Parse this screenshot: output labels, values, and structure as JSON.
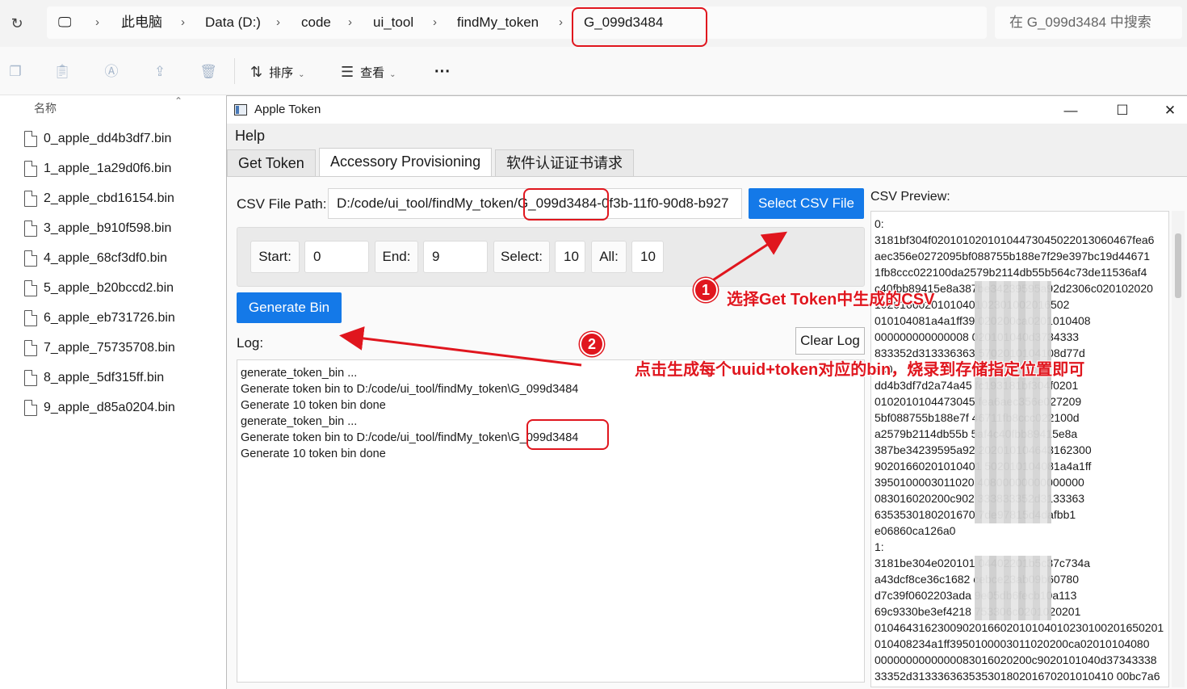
{
  "explorer": {
    "breadcrumb": [
      "此电脑",
      "Data (D:)",
      "code",
      "ui_tool",
      "findMy_token",
      "G_099d3484"
    ],
    "search_placeholder": "在 G_099d3484 中搜索",
    "toolbar": {
      "sort_label": "排序",
      "view_label": "查看",
      "more_label": "···"
    },
    "column_name": "名称",
    "files": [
      "0_apple_dd4b3df7.bin",
      "1_apple_1a29d0f6.bin",
      "2_apple_cbd16154.bin",
      "3_apple_b910f598.bin",
      "4_apple_68cf3df0.bin",
      "5_apple_b20bccd2.bin",
      "6_apple_eb731726.bin",
      "7_apple_75735708.bin",
      "8_apple_5df315ff.bin",
      "9_apple_d85a0204.bin"
    ]
  },
  "app": {
    "title": "Apple Token",
    "menu_help": "Help",
    "tabs": [
      "Get Token",
      "Accessory Provisioning",
      "软件认证证书请求"
    ],
    "active_tab": 1,
    "csv_label": "CSV File Path:",
    "csv_path": "D:/code/ui_tool/findMy_token/G_099d3484-0f3b-11f0-90d8-b927",
    "select_csv_button": "Select CSV File",
    "range": {
      "start_label": "Start:",
      "start_value": "0",
      "end_label": "End:",
      "end_value": "9",
      "select_label": "Select:",
      "select_value": "10",
      "all_label": "All:",
      "all_value": "10"
    },
    "generate_bin_button": "Generate Bin",
    "log_label": "Log:",
    "clear_log_button": "Clear Log",
    "log_lines": [
      "generate_token_bin ...",
      "Generate token bin to D:/code/ui_tool/findMy_token\\G_099d3484",
      "Generate 10 token bin done",
      "generate_token_bin ...",
      "Generate token bin to D:/code/ui_tool/findMy_token\\G_099d3484",
      "Generate 10 token bin done"
    ],
    "preview_label": "CSV Preview:",
    "preview_lines": [
      "0:",
      "3181bf304f02010102010104473045022013060467fea6",
      "aec356e0272095bf088755b188e7f29e397bc19d44671",
      "1fb8ccc022100da2579b2114db55b564c73de11536af4",
      "c40fbb89415e8a387be34239595a92d2306c020102020",
      "1020166020101040102301002016502",
      "010104081a4a1ff39 020200ca0201010408",
      "000000000000008 020101040d3734333",
      "833352d313336363 5702010104108d77d",
      "4c0",
      "dd4b3df7d2a74a45 fc193181bf304f0201",
      "0102010104473045 fea6aec356e027209",
      "5bf088755b188e7f 46711fb8ccc022100d",
      "a2579b2114db55b 5af4c40fbb89415e8a",
      "387be34239595a92 202010104643162300",
      "90201660201010401 502010104081a4a1ff",
      "3950100003011020 40800000000000000",
      "083016020200c902 333833352d3133363",
      "6353530180201670 7de97815d4dafbb1",
      "e06860ca126a0",
      "1:",
      "3181be304e020101 04402201b5c37c734a",
      "a43dcf8ce36c1682 cebce23ab09b60780",
      "d7c39f0602203ada 9e05db6fecb10a113",
      "69c9330be3ef4218 753306c0201020201",
      "0104643162300902016602010104010230100201650201",
      "010408234a1ff3950100003011020200ca02010104080",
      "0000000000000083016020200c9020101040d37343338",
      "33352d31333636353530180201670201010410 00bc7a6"
    ]
  },
  "annotations": {
    "step1_number": "1",
    "step1_text": "选择Get Token中生成的CSV",
    "step2_number": "2",
    "step2_text": "点击生成每个uuid+token对应的bin，烧录到存储指定位置即可",
    "highlight_color": "#e0161e"
  }
}
